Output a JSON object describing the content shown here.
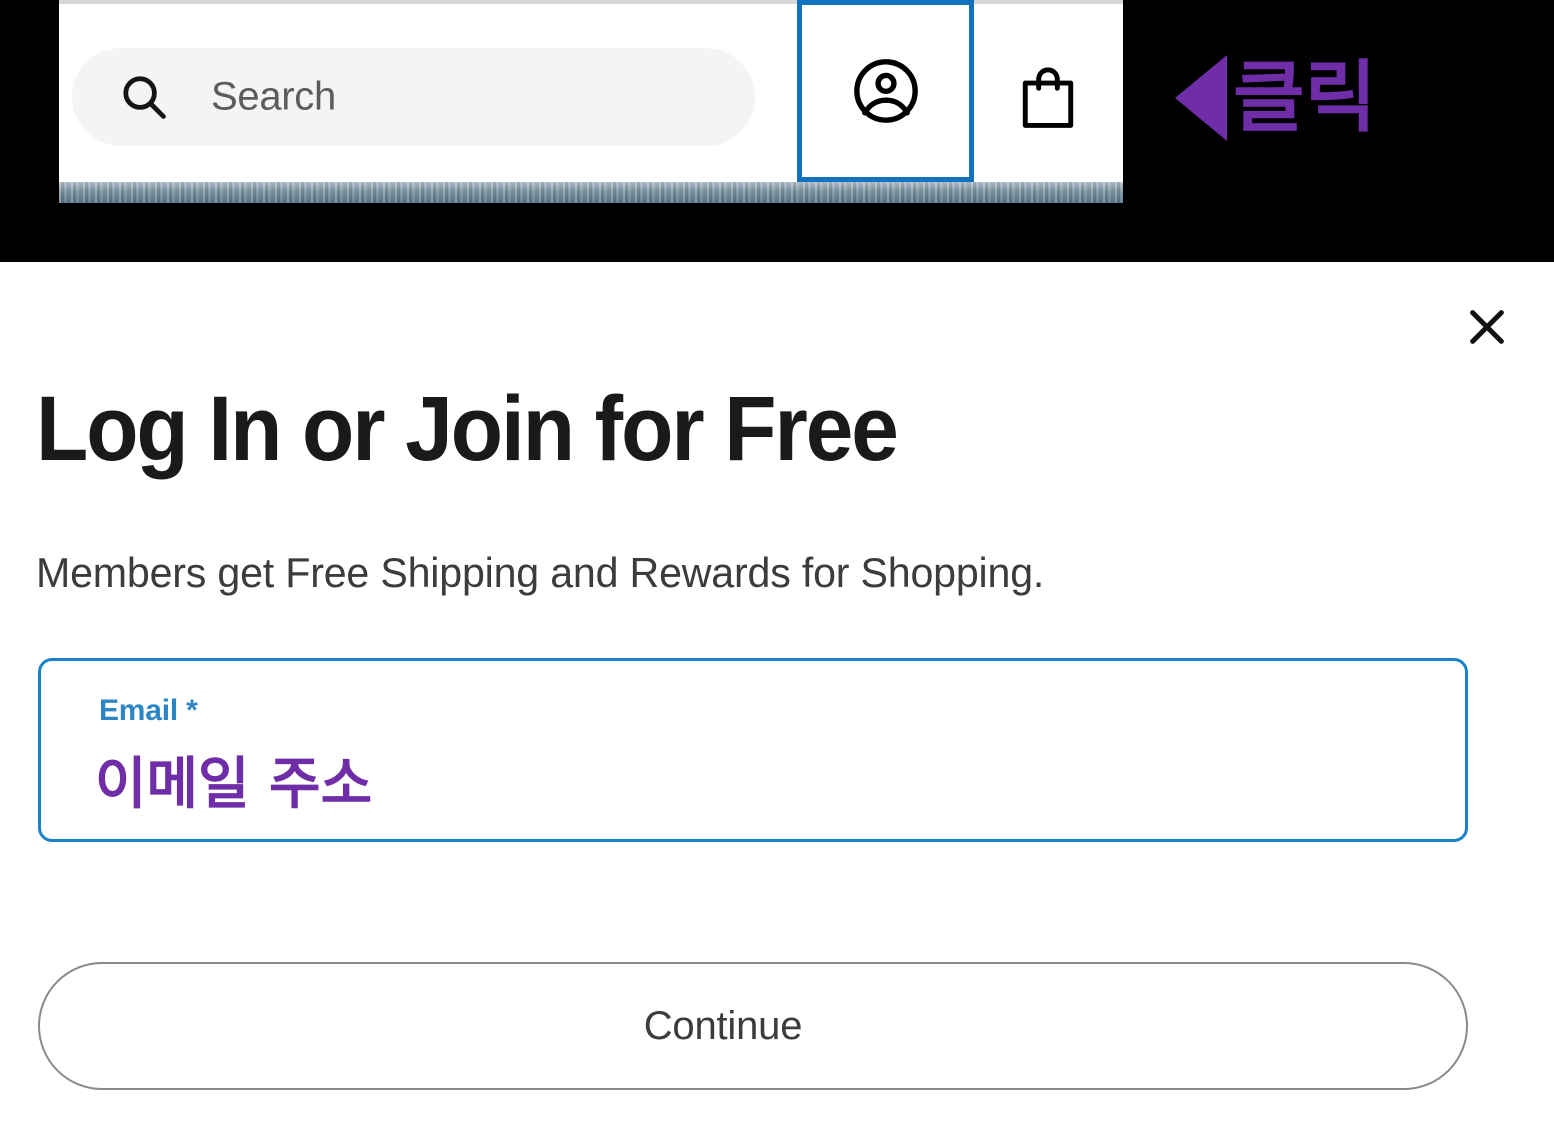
{
  "browser_header": {
    "search": {
      "placeholder": "Search",
      "icon": "search-icon"
    },
    "account_button": {
      "icon": "account-circle-icon",
      "focused": true,
      "focus_color": "#1272be"
    },
    "bag_button": {
      "icon": "shopping-bag-icon"
    }
  },
  "annotation": {
    "label": "클릭",
    "color": "#6f2da8",
    "arrow": "left-triangle"
  },
  "modal": {
    "close_icon": "close-x-icon",
    "title": "Log In or Join for Free",
    "subtitle": "Members get Free Shipping and Rewards for Shopping.",
    "email": {
      "label": "Email *",
      "value": "이메일 주소",
      "placeholder": "Email *",
      "border_color": "#1a82c8",
      "label_color": "#2d86c4",
      "value_color": "#6f2da8"
    },
    "continue_label": "Continue"
  }
}
